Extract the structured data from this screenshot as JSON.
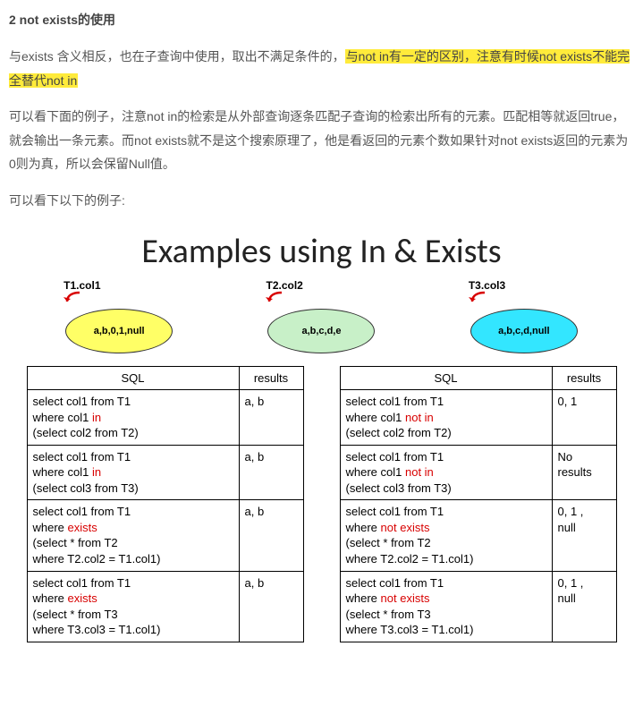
{
  "heading": "2 not exists的使用",
  "p1_a": "与exists 含义相反，也在子查询中使用，取出不满足条件的，",
  "p1_hl": "与not in有一定的区别，注意有时候not exists不能完全替代not in",
  "p2": "可以看下面的例子，注意not in的检索是从外部查询逐条匹配子查询的检索出所有的元素。匹配相等就返回true，就会输出一条元素。而not exists就不是这个搜索原理了，他是看返回的元素个数如果针对not exists返回的元素为0则为真，所以会保留Null值。",
  "p3": "可以看下以下的例子:",
  "figure": {
    "title": "Examples using In & Exists",
    "ovals": [
      {
        "label": "T1.col1",
        "content": "a,b,0,1,null",
        "fill": "#ffff66"
      },
      {
        "label": "T2.col2",
        "content": "a,b,c,d,e",
        "fill": "#c8f0c8"
      },
      {
        "label": "T3.col3",
        "content": "a,b,c,d,null",
        "fill": "#33e6ff"
      }
    ],
    "left_table": {
      "headers": [
        "SQL",
        "results"
      ],
      "rows": [
        {
          "sql": [
            {
              "t": "select col1 from  T1"
            },
            {
              "t": "where col1 ",
              "kw": "in"
            },
            {
              "t": "(select col2 from T2)"
            }
          ],
          "result": "a, b"
        },
        {
          "sql": [
            {
              "t": "select col1 from  T1"
            },
            {
              "t": "where col1 ",
              "kw": "in"
            },
            {
              "t": "(select col3 from T3)"
            }
          ],
          "result": "a, b"
        },
        {
          "sql": [
            {
              "t": "select col1 from  T1"
            },
            {
              "t": "where ",
              "kw": "exists"
            },
            {
              "t": "(select * from T2"
            },
            {
              "t": "where T2.col2 = T1.col1)"
            }
          ],
          "result": "a, b"
        },
        {
          "sql": [
            {
              "t": "select col1 from  T1"
            },
            {
              "t": "where ",
              "kw": "exists"
            },
            {
              "t": "(select * from T3"
            },
            {
              "t": "where T3.col3 = T1.col1)"
            }
          ],
          "result": "a, b"
        }
      ]
    },
    "right_table": {
      "headers": [
        "SQL",
        "results"
      ],
      "rows": [
        {
          "sql": [
            {
              "t": "select col1 from  T1"
            },
            {
              "t": "where col1 ",
              "kw": "not in"
            },
            {
              "t": "(select col2 from T2)"
            }
          ],
          "result": "0, 1"
        },
        {
          "sql": [
            {
              "t": "select col1 from  T1"
            },
            {
              "t": "where col1 ",
              "kw": "not in"
            },
            {
              "t": "(select col3 from T3)"
            }
          ],
          "result": "No results"
        },
        {
          "sql": [
            {
              "t": "select col1 from  T1"
            },
            {
              "t": "where ",
              "kw": "not exists"
            },
            {
              "t": "(select * from T2"
            },
            {
              "t": "where T2.col2 = T1.col1)"
            }
          ],
          "result": "0, 1 , null"
        },
        {
          "sql": [
            {
              "t": "select col1 from  T1"
            },
            {
              "t": "where ",
              "kw": "not exists"
            },
            {
              "t": "(select * from T3"
            },
            {
              "t": "where T3.col3 = T1.col1)"
            }
          ],
          "result": "0, 1 , null"
        }
      ]
    }
  }
}
